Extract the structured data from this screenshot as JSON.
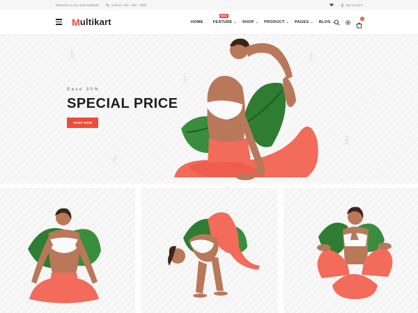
{
  "topbar": {
    "welcome": "Welcome to Our store Multikart",
    "phone": "Call Us: 123 - 456 - 7890",
    "account": "My Account"
  },
  "header": {
    "logo_initial": "M",
    "logo_text": "ultikart",
    "nav": [
      {
        "label": "HOME"
      },
      {
        "label": "FEATURE",
        "badge": "NEW"
      },
      {
        "label": "SHOP"
      },
      {
        "label": "PRODUCT"
      },
      {
        "label": "PAGES"
      },
      {
        "label": "BLOG"
      }
    ],
    "cart_count": "0"
  },
  "hero": {
    "subtitle": "Save 30%",
    "title": "SPECIAL PRICE",
    "button": "SHOP NOW"
  },
  "colors": {
    "accent": "#ef4b3c",
    "legging": "#f26b5b",
    "leaf": "#2e7d32",
    "skin": "#b9785a"
  }
}
